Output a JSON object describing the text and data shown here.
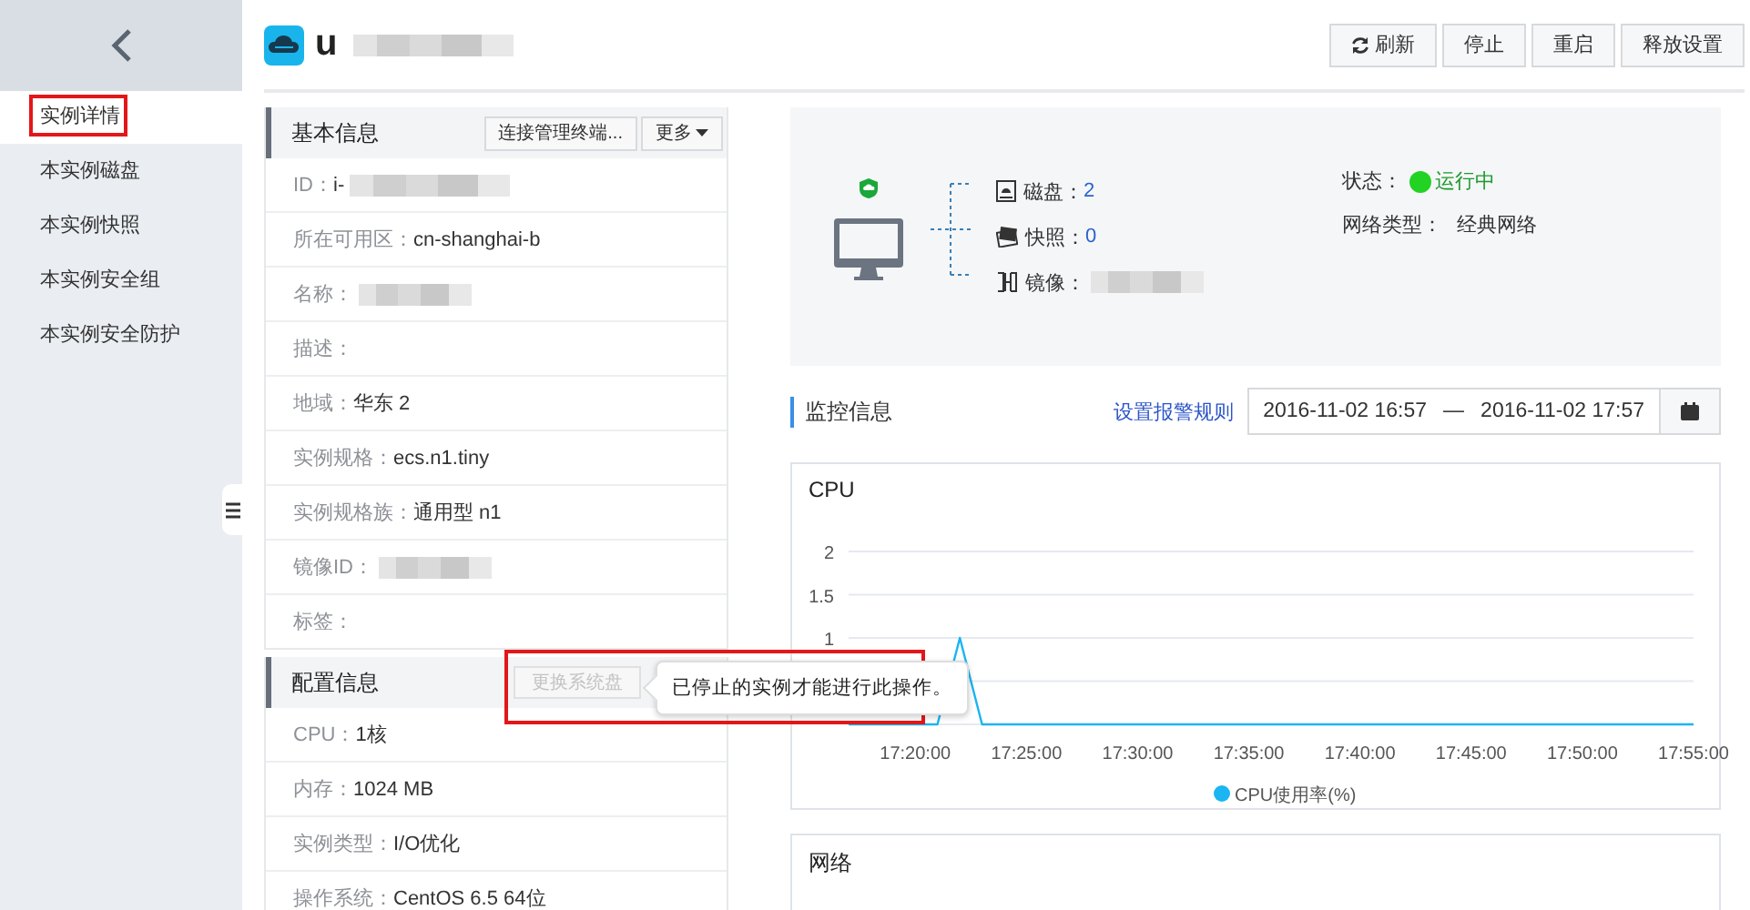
{
  "sidebar": {
    "items": [
      {
        "label": "实例详情",
        "selected": true,
        "highlighted": true
      },
      {
        "label": "本实例磁盘",
        "selected": false
      },
      {
        "label": "本实例快照",
        "selected": false
      },
      {
        "label": "本实例安全组",
        "selected": false
      },
      {
        "label": "本实例安全防护",
        "selected": false
      }
    ]
  },
  "header": {
    "title": "u",
    "redacted": true,
    "buttons": [
      {
        "label": "刷新",
        "kind": "refresh"
      },
      {
        "label": "停止",
        "kind": "plain"
      },
      {
        "label": "重启",
        "kind": "plain"
      },
      {
        "label": "释放设置",
        "kind": "plain"
      }
    ]
  },
  "basic_info": {
    "title": "基本信息",
    "buttons": [
      {
        "label": "连接管理终端...",
        "kind": "plain"
      },
      {
        "label": "更多",
        "kind": "dropdown"
      }
    ],
    "fields": [
      {
        "label": "ID：",
        "value": "i-",
        "redacted": true
      },
      {
        "label": "所在可用区：",
        "value": "cn-shanghai-b"
      },
      {
        "label": "名称：",
        "redacted": true
      },
      {
        "label": "描述："
      },
      {
        "label": "地域：",
        "value": "华东 2"
      },
      {
        "label": "实例规格：",
        "value": "ecs.n1.tiny"
      },
      {
        "label": "实例规格族：",
        "value": "通用型 n1"
      },
      {
        "label": "镜像ID：",
        "redacted": true
      },
      {
        "label": "标签："
      }
    ]
  },
  "config_info": {
    "title": "配置信息",
    "action": {
      "label": "更换系统盘",
      "disabled": true
    },
    "tooltip": "已停止的实例才能进行此操作。",
    "highlighted": true,
    "fields": [
      {
        "label": "CPU：",
        "value": "1核"
      },
      {
        "label": "内存：",
        "value": "1024 MB"
      },
      {
        "label": "实例类型：",
        "value": "I/O优化"
      },
      {
        "label": "操作系统：",
        "value": "CentOS 6.5 64位"
      }
    ]
  },
  "summary": {
    "resources": [
      {
        "kind": "disk",
        "label": "磁盘：",
        "value": "2"
      },
      {
        "kind": "snapshot",
        "label": "快照：",
        "value": "0"
      },
      {
        "kind": "image",
        "label": "镜像：",
        "redacted": true
      }
    ],
    "status": {
      "label": "状态：",
      "value": "运行中",
      "running": true
    },
    "network": {
      "label": "网络类型：",
      "value": "经典网络"
    }
  },
  "monitor": {
    "title": "监控信息",
    "alert_link": "设置报警规则",
    "start": "2016-11-02 16:57",
    "separator": "—",
    "end": "2016-11-02 17:57"
  },
  "charts": [
    {
      "title": "CPU",
      "chart_data": {
        "type": "line",
        "categories": [
          null,
          null,
          null,
          "17:20:00",
          null,
          null,
          null,
          null,
          "17:25:00",
          null,
          null,
          null,
          null,
          "17:30:00",
          null,
          null,
          null,
          null,
          "17:35:00",
          null,
          null,
          null,
          null,
          "17:40:00",
          null,
          null,
          null,
          null,
          "17:45:00",
          null,
          null,
          null,
          null,
          "17:50:00",
          null,
          null,
          null,
          null,
          "17:55:00"
        ],
        "series": [
          {
            "name": "CPU使用率(%)",
            "color": "#1ab5f2",
            "values": [
              0,
              0,
              0,
              0,
              0,
              1,
              0,
              0,
              0,
              0,
              0,
              0,
              0,
              0,
              0,
              0,
              0,
              0,
              0,
              0,
              0,
              0,
              0,
              0,
              0,
              0,
              0,
              0,
              0,
              0,
              0,
              0,
              0,
              0,
              0,
              0,
              0,
              0,
              0
            ]
          }
        ],
        "ylim": [
          0,
          2
        ],
        "yticks": [
          1,
          1.5,
          2
        ]
      }
    },
    {
      "title": "网络"
    }
  ]
}
